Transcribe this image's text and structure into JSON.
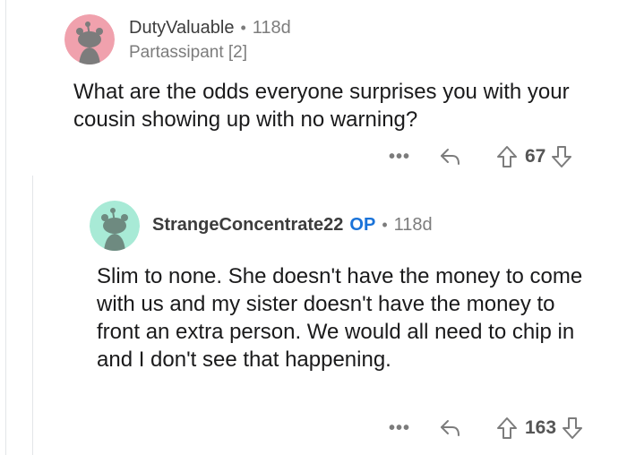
{
  "comments": [
    {
      "username": "DutyValuable",
      "separator": "•",
      "age": "118d",
      "flair": "Partassipant [2]",
      "body": "What are the odds everyone surprises you with your cousin showing up with no warning?",
      "more_label": "•••",
      "score": "67",
      "avatar_color": "#f0a1ad"
    },
    {
      "username": "StrangeConcentrate22",
      "op_label": "OP",
      "separator": "•",
      "age": "118d",
      "body": "Slim to none. She doesn't have the money to come with us and my sister doesn't have the money to front an extra person. We would all need to chip in and I don't see that happening.",
      "more_label": "•••",
      "score": "163",
      "avatar_color": "#a8ead6"
    }
  ],
  "colors": {
    "op": "#1a73d9",
    "muted": "#7c7c7c",
    "text": "#1a1a1b",
    "thread_line": "#e3e5e8"
  },
  "icons": {
    "reply": "reply-arrow-icon",
    "upvote": "upvote-arrow-icon",
    "downvote": "downvote-arrow-icon",
    "more": "more-options-icon"
  }
}
